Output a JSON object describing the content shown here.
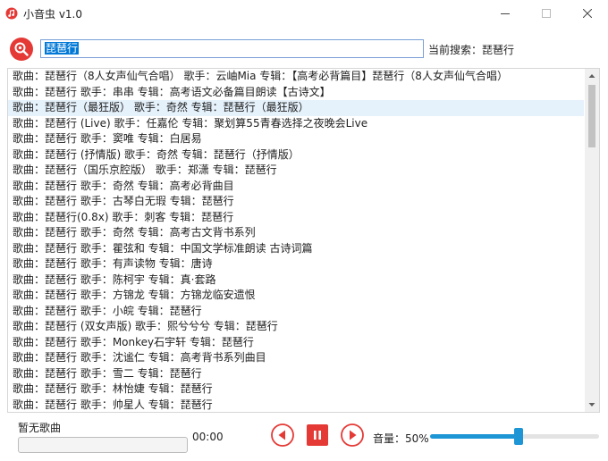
{
  "window": {
    "title": "小音虫 v1.0"
  },
  "search": {
    "query": "琵琶行",
    "current_label": "当前搜索：",
    "current_value": "琵琶行"
  },
  "results": [
    "歌曲：琵琶行（8人女声仙气合唱） 歌手：云岫Mia 专辑：【高考必背篇目】琵琶行（8人女声仙气合唱）",
    "歌曲：琵琶行 歌手：串串 专辑：高考语文必备篇目朗读【古诗文】",
    "歌曲：琵琶行（最狂版） 歌手：奇然 专辑：琵琶行（最狂版）",
    "歌曲：琵琶行 (Live) 歌手：任嘉伦 专辑：聚划算55青春选择之夜晚会Live",
    "歌曲：琵琶行 歌手：窦唯 专辑：白居易",
    "歌曲：琵琶行 (抒情版) 歌手：奇然 专辑：琵琶行（抒情版）",
    "歌曲：琵琶行（国乐京腔版） 歌手：郑潇 专辑：琵琶行",
    "歌曲：琵琶行 歌手：奇然 专辑：高考必背曲目",
    "歌曲：琵琶行 歌手：古琴白无瑕 专辑：琵琶行",
    "歌曲：琵琶行(0.8x) 歌手：刺客 专辑：琵琶行",
    "歌曲：琵琶行 歌手：奇然 专辑：高考古文背书系列",
    "歌曲：琵琶行 歌手：瞿弦和 专辑：中国文学标准朗读 古诗词篇",
    "歌曲：琵琶行 歌手：有声读物 专辑：唐诗",
    "歌曲：琵琶行 歌手：陈柯宇 专辑：真·套路",
    "歌曲：琵琶行 歌手：方锦龙 专辑：方锦龙临安遗恨",
    "歌曲：琵琶行 歌手：小皖 专辑：琵琶行",
    "歌曲：琵琶行 (双女声版) 歌手：熙兮兮兮 专辑：琵琶行",
    "歌曲：琵琶行 歌手：Monkey石宇轩 专辑：琵琶行",
    "歌曲：琵琶行 歌手：沈谧仁 专辑：高考背书系列曲目",
    "歌曲：琵琶行 歌手：雪二 专辑：琵琶行",
    "歌曲：琵琶行 歌手：林怡婕 专辑：琵琶行",
    "歌曲：琵琶行 歌手：帅星人 专辑：琵琶行"
  ],
  "selected_index": 2,
  "player": {
    "song_name": "暂无歌曲",
    "time": "00:00",
    "progress": 0,
    "volume_label": "音量：",
    "volume_value": "50%",
    "volume_level": 0.5
  },
  "icons": {
    "app": "music-note-icon",
    "logo": "search-music-icon",
    "prev": "previous-track-icon",
    "pause": "pause-icon",
    "next": "next-track-icon"
  },
  "colors": {
    "accent_red": "#e53935",
    "accent_blue": "#1e96d6",
    "selection": "#e5f1fb"
  }
}
